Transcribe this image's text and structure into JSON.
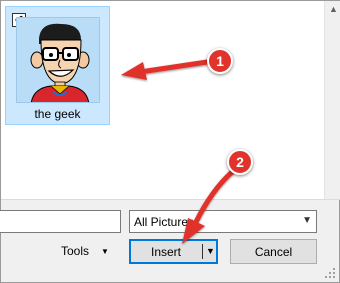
{
  "file_list": {
    "items": [
      {
        "name": "the geek",
        "checked": true,
        "selected": true
      }
    ]
  },
  "footer": {
    "file_name_value": "",
    "file_type_selected": "All Pictures",
    "tools_label": "Tools",
    "insert_label": "Insert",
    "cancel_label": "Cancel"
  },
  "annotations": {
    "badges": [
      "1",
      "2"
    ],
    "color": "#e0332c"
  },
  "icons": [
    "checkmark-icon",
    "chevron-down-icon",
    "resize-grip-icon",
    "scroll-up-arrow-icon"
  ]
}
